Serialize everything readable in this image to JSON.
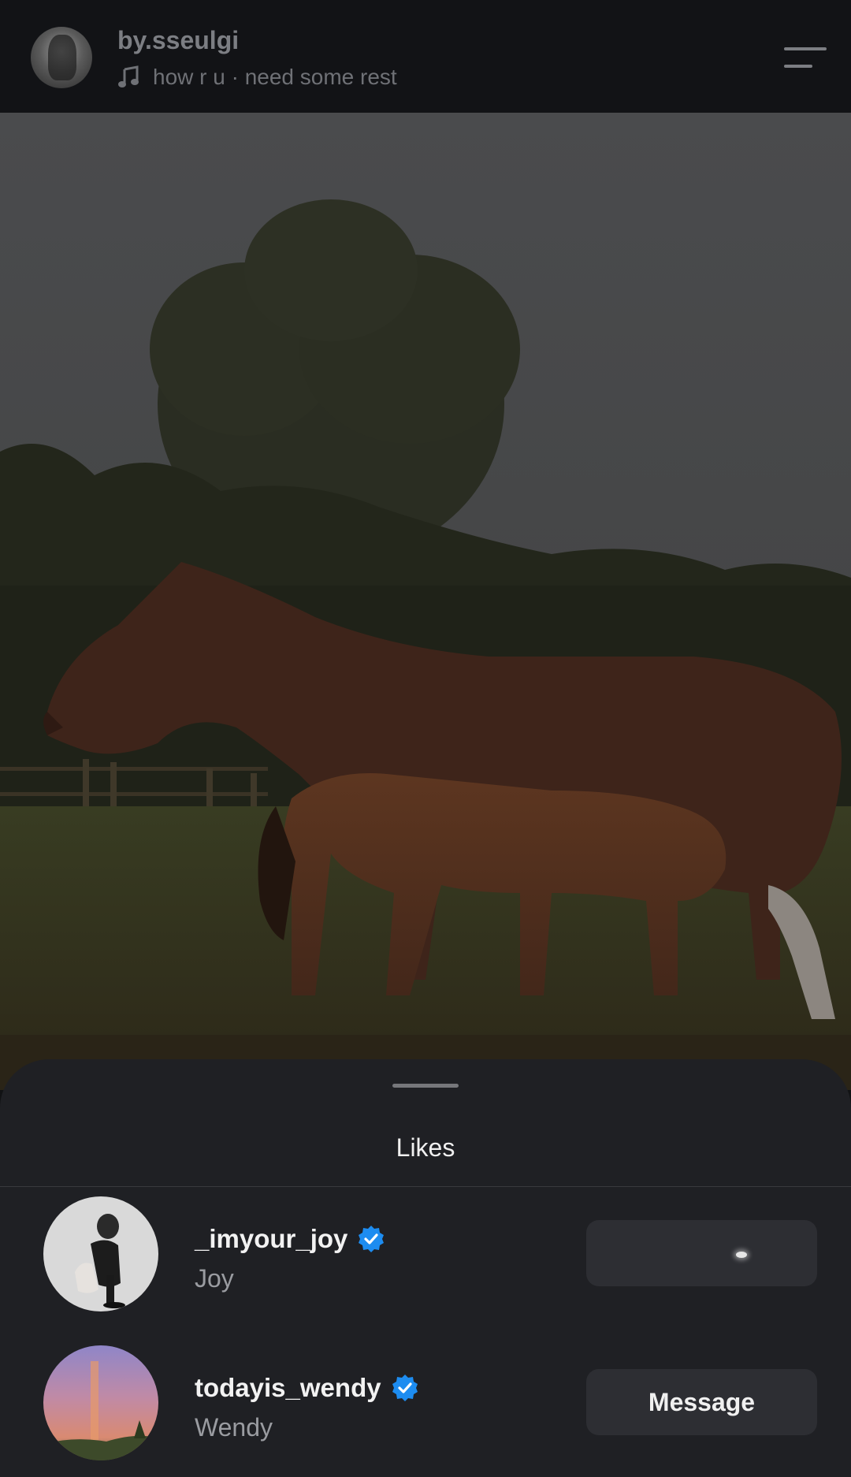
{
  "header": {
    "username": "by.sseulgi",
    "music_icon": "music-note-icon",
    "music_text": "how r u · need some rest",
    "menu_icon": "menu-lines-icon"
  },
  "likes_sheet": {
    "title": "Likes",
    "users": [
      {
        "handle": "_imyour_joy",
        "name": "Joy",
        "verified": true,
        "button_label": ""
      },
      {
        "handle": "todayis_wendy",
        "name": "Wendy",
        "verified": true,
        "button_label": "Message"
      }
    ]
  },
  "colors": {
    "background": "#121316",
    "sheet": "#1f2024",
    "button": "#2d2e33",
    "verified": "#1d8cf0",
    "secondary_text": "#9a9ca1"
  }
}
